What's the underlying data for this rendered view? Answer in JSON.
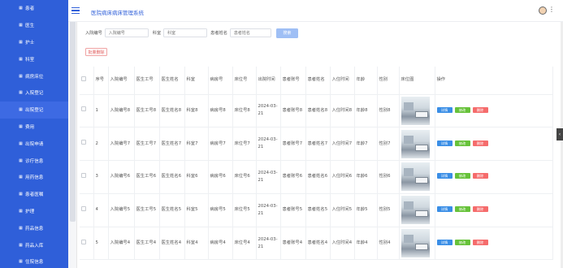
{
  "app": {
    "title": "医院病床病床管理系统"
  },
  "sidebar": {
    "items": [
      {
        "label": "患者"
      },
      {
        "label": "医生"
      },
      {
        "label": "护士"
      },
      {
        "label": "科室"
      },
      {
        "label": "病房床位"
      },
      {
        "label": "入院登记"
      },
      {
        "label": "出院登记"
      },
      {
        "label": "费用"
      },
      {
        "label": "出院申请"
      },
      {
        "label": "诊疗信息"
      },
      {
        "label": "用药信息"
      },
      {
        "label": "患者医嘱"
      },
      {
        "label": "护理"
      },
      {
        "label": "药品信息"
      },
      {
        "label": "药品入库"
      },
      {
        "label": "住院信息"
      }
    ],
    "active_index": 6
  },
  "search": {
    "label_admission": "入院编号",
    "placeholder_admission": "入院编号",
    "label_dept": "科室",
    "placeholder_dept": "科室",
    "label_patient": "患者姓名",
    "placeholder_patient": "患者姓名",
    "search_label": "搜索",
    "batch_delete_label": "批量删除"
  },
  "table": {
    "headers": [
      "序号",
      "入院编号",
      "医生工号",
      "医生姓名",
      "科室",
      "病房号",
      "床位号",
      "出院时间",
      "患者账号",
      "患者姓名",
      "入住时间",
      "年龄",
      "性别",
      "床位图",
      "操作"
    ],
    "rows": [
      {
        "idx": "1",
        "admission": "入院编号8",
        "doc_id": "医生工号8",
        "doc_name": "医生姓名8",
        "dept": "科室8",
        "ward": "病房号8",
        "bed": "床位号8",
        "discharge": "2024-03-21",
        "patient_acct": "患者账号8",
        "patient_name": "患者姓名8",
        "checkin": "入住时间8",
        "age": "年龄8",
        "gender": "性别8"
      },
      {
        "idx": "2",
        "admission": "入院编号7",
        "doc_id": "医生工号7",
        "doc_name": "医生姓名7",
        "dept": "科室7",
        "ward": "病房号7",
        "bed": "床位号7",
        "discharge": "2024-03-21",
        "patient_acct": "患者账号7",
        "patient_name": "患者姓名7",
        "checkin": "入住时间7",
        "age": "年龄7",
        "gender": "性别7"
      },
      {
        "idx": "3",
        "admission": "入院编号6",
        "doc_id": "医生工号6",
        "doc_name": "医生姓名6",
        "dept": "科室6",
        "ward": "病房号6",
        "bed": "床位号6",
        "discharge": "2024-03-21",
        "patient_acct": "患者账号6",
        "patient_name": "患者姓名6",
        "checkin": "入住时间6",
        "age": "年龄6",
        "gender": "性别6"
      },
      {
        "idx": "4",
        "admission": "入院编号5",
        "doc_id": "医生工号5",
        "doc_name": "医生姓名5",
        "dept": "科室5",
        "ward": "病房号5",
        "bed": "床位号5",
        "discharge": "2024-03-21",
        "patient_acct": "患者账号5",
        "patient_name": "患者姓名5",
        "checkin": "入住时间5",
        "age": "年龄5",
        "gender": "性别5"
      },
      {
        "idx": "5",
        "admission": "入院编号4",
        "doc_id": "医生工号4",
        "doc_name": "医生姓名4",
        "dept": "科室4",
        "ward": "病房号4",
        "bed": "床位号4",
        "discharge": "2024-03-21",
        "patient_acct": "患者账号4",
        "patient_name": "患者姓名4",
        "checkin": "入住时间4",
        "age": "年龄4",
        "gender": "性别4"
      }
    ],
    "ops": {
      "detail": "详情",
      "edit": "修改",
      "delete": "删除"
    }
  },
  "icons": {
    "sidebar_item": "grid-icon",
    "menu": "hamburger-icon",
    "more": "kebab-icon"
  },
  "colors": {
    "sidebar": "#2f5fd9",
    "detail": "#3a8ee6",
    "edit": "#67c23a",
    "delete": "#f56c6c"
  }
}
